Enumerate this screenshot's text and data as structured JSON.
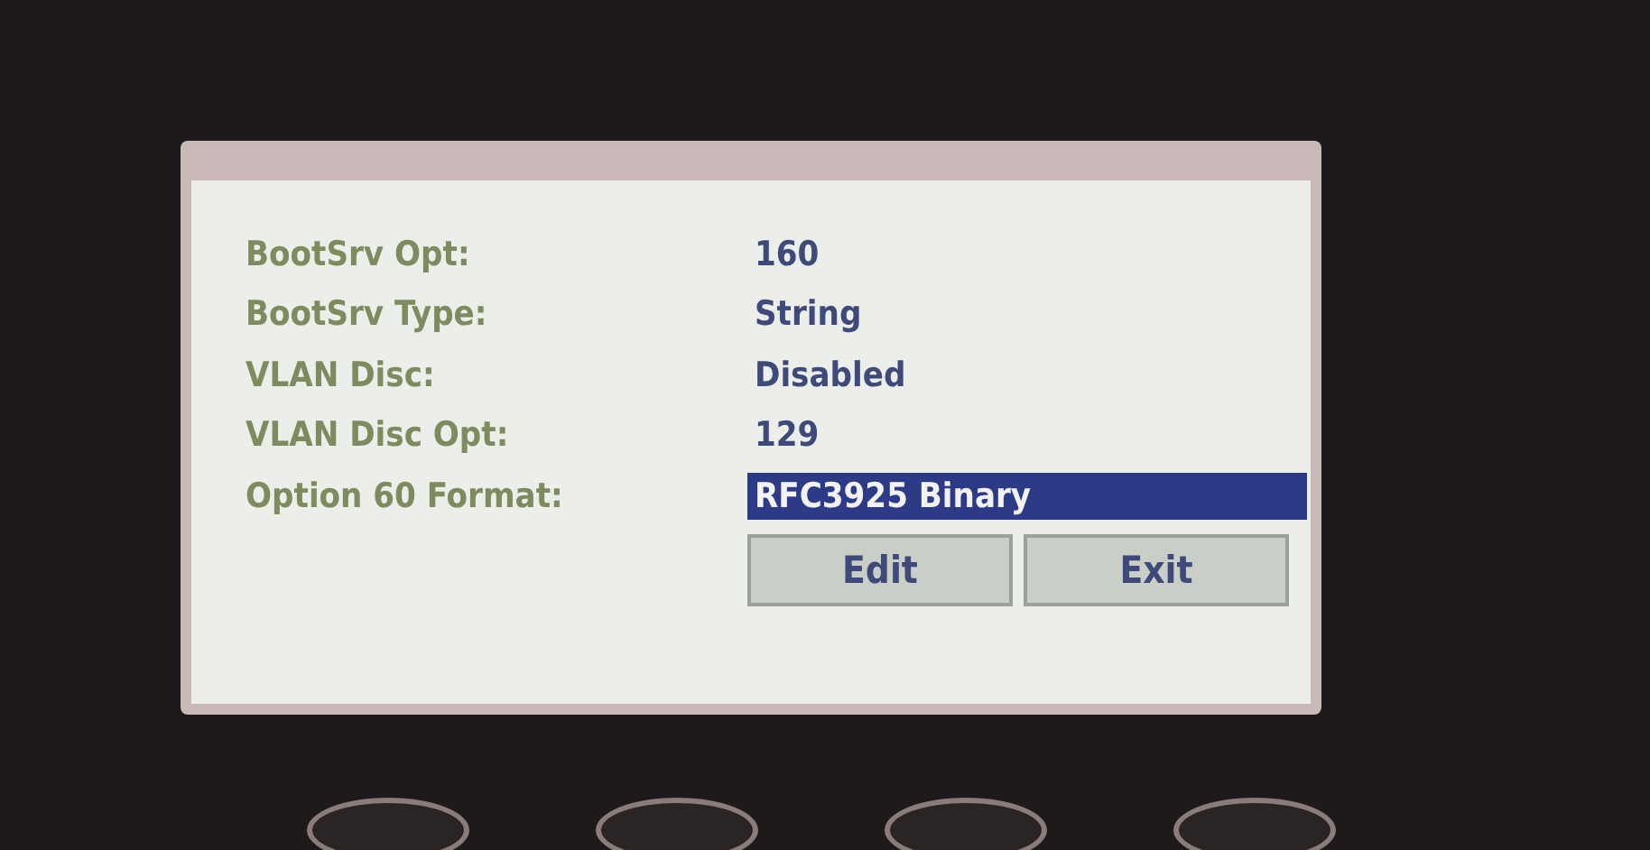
{
  "settings": [
    {
      "label": "BootSrv Opt:",
      "value": "160",
      "selected": false
    },
    {
      "label": "BootSrv Type:",
      "value": "String",
      "selected": false
    },
    {
      "label": "VLAN Disc:",
      "value": "Disabled",
      "selected": false
    },
    {
      "label": "VLAN Disc Opt:",
      "value": "129",
      "selected": false
    },
    {
      "label": "Option 60 Format:",
      "value": "RFC3925 Binary",
      "selected": true
    }
  ],
  "softkeys": [
    "Edit",
    "Exit"
  ]
}
